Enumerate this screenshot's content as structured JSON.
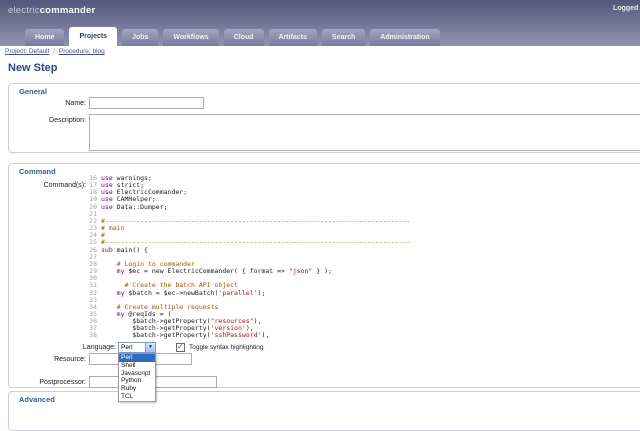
{
  "header": {
    "logo": {
      "light": "electric",
      "bold": "commander"
    },
    "logged_text": "Logged",
    "tabs": [
      {
        "label": "Home",
        "active": false
      },
      {
        "label": "Projects",
        "active": true
      },
      {
        "label": "Jobs",
        "active": false
      },
      {
        "label": "Workflows",
        "active": false
      },
      {
        "label": "Cloud",
        "active": false
      },
      {
        "label": "Artifacts",
        "active": false
      },
      {
        "label": "Search",
        "active": false
      },
      {
        "label": "Administration",
        "active": false
      }
    ]
  },
  "breadcrumb": {
    "separator": "/",
    "items": [
      "Project: Default",
      "Procedure: blog"
    ]
  },
  "page": {
    "title": "New Step"
  },
  "sections": {
    "general": {
      "title": "General",
      "name": {
        "label": "Name:",
        "value": ""
      },
      "description": {
        "label": "Description:",
        "value": ""
      }
    },
    "command": {
      "title": "Command",
      "command_label": "Command(s):",
      "language": {
        "label": "Language:",
        "selected": "Perl",
        "options": [
          "Perl",
          "Shell",
          "Javascript",
          "Python",
          "Ruby",
          "TCL"
        ]
      },
      "toggle_label": "Toggle syntax highlighting",
      "toggle_checked": true,
      "resource": {
        "label": "Resource:",
        "value": ""
      },
      "postprocessor": {
        "label": "Postprocessor:",
        "value": ""
      },
      "code": {
        "language": "Perl",
        "lines": [
          {
            "n": 16,
            "tokens": [
              {
                "t": "k",
                "v": "use"
              },
              {
                "t": "p",
                "v": " warnings;"
              }
            ]
          },
          {
            "n": 17,
            "tokens": [
              {
                "t": "k",
                "v": "use"
              },
              {
                "t": "p",
                "v": " strict;"
              }
            ]
          },
          {
            "n": 18,
            "tokens": [
              {
                "t": "k",
                "v": "use"
              },
              {
                "t": "p",
                "v": " ElectricCommander;"
              }
            ]
          },
          {
            "n": 19,
            "tokens": [
              {
                "t": "k",
                "v": "use"
              },
              {
                "t": "p",
                "v": " CAMHelper;"
              }
            ]
          },
          {
            "n": 20,
            "tokens": [
              {
                "t": "k",
                "v": "use"
              },
              {
                "t": "p",
                "v": " Data::Dumper;"
              }
            ]
          },
          {
            "n": 21,
            "tokens": []
          },
          {
            "n": 22,
            "tokens": [
              {
                "t": "c",
                "v": "#------------------------------------------------------------------------------"
              }
            ]
          },
          {
            "n": 23,
            "tokens": [
              {
                "t": "c",
                "v": "# main"
              }
            ]
          },
          {
            "n": 24,
            "tokens": [
              {
                "t": "c",
                "v": "#"
              }
            ]
          },
          {
            "n": 25,
            "tokens": [
              {
                "t": "c",
                "v": "#------------------------------------------------------------------------------"
              }
            ]
          },
          {
            "n": 26,
            "tokens": [
              {
                "t": "k",
                "v": "sub"
              },
              {
                "t": "p",
                "v": " main() {"
              }
            ]
          },
          {
            "n": 27,
            "tokens": []
          },
          {
            "n": 28,
            "tokens": [
              {
                "t": "p",
                "v": "    "
              },
              {
                "t": "c",
                "v": "# Login to commander"
              }
            ]
          },
          {
            "n": 29,
            "tokens": [
              {
                "t": "p",
                "v": "    "
              },
              {
                "t": "k",
                "v": "my"
              },
              {
                "t": "p",
                "v": " $ec = new ElectricCommander( { format => "
              },
              {
                "t": "s",
                "v": "\"json\""
              },
              {
                "t": "p",
                "v": " } );"
              }
            ]
          },
          {
            "n": 30,
            "tokens": []
          },
          {
            "n": 31,
            "tokens": [
              {
                "t": "p",
                "v": "      "
              },
              {
                "t": "c",
                "v": "# Create the batch API object"
              }
            ]
          },
          {
            "n": 32,
            "tokens": [
              {
                "t": "p",
                "v": "    "
              },
              {
                "t": "k",
                "v": "my"
              },
              {
                "t": "p",
                "v": " $batch = $ec->newBatch("
              },
              {
                "t": "s",
                "v": "'parallel'"
              },
              {
                "t": "p",
                "v": ");"
              }
            ]
          },
          {
            "n": 33,
            "tokens": []
          },
          {
            "n": 34,
            "tokens": [
              {
                "t": "p",
                "v": "    "
              },
              {
                "t": "c",
                "v": "# Create multiple requests"
              }
            ]
          },
          {
            "n": 35,
            "tokens": [
              {
                "t": "p",
                "v": "    "
              },
              {
                "t": "k",
                "v": "my"
              },
              {
                "t": "p",
                "v": " @reqIds = ("
              }
            ]
          },
          {
            "n": 36,
            "tokens": [
              {
                "t": "p",
                "v": "        $batch->getProperty("
              },
              {
                "t": "s",
                "v": "\"resources\""
              },
              {
                "t": "p",
                "v": "),"
              }
            ]
          },
          {
            "n": 37,
            "tokens": [
              {
                "t": "p",
                "v": "        $batch->getProperty("
              },
              {
                "t": "s",
                "v": "'version'"
              },
              {
                "t": "p",
                "v": "),"
              }
            ]
          },
          {
            "n": 38,
            "tokens": [
              {
                "t": "p",
                "v": "        $batch->getProperty("
              },
              {
                "t": "s",
                "v": "'sshPassword'"
              },
              {
                "t": "p",
                "v": "),"
              }
            ]
          }
        ]
      }
    },
    "advanced": {
      "title": "Advanced"
    }
  },
  "colors": {
    "header_top": "#53577b",
    "header_bottom": "#9194af",
    "tab_active_text": "#333c66",
    "link": "#47528a",
    "page_title": "#274790",
    "section_title": "#3a5a9a",
    "box_border": "#c9cdda",
    "dropdown_selected_bg": "#316ac5",
    "code_keyword": "#770088",
    "code_string": "#aa1111",
    "code_comment": "#aa5500",
    "code_linenumber": "#9aa0a8"
  }
}
